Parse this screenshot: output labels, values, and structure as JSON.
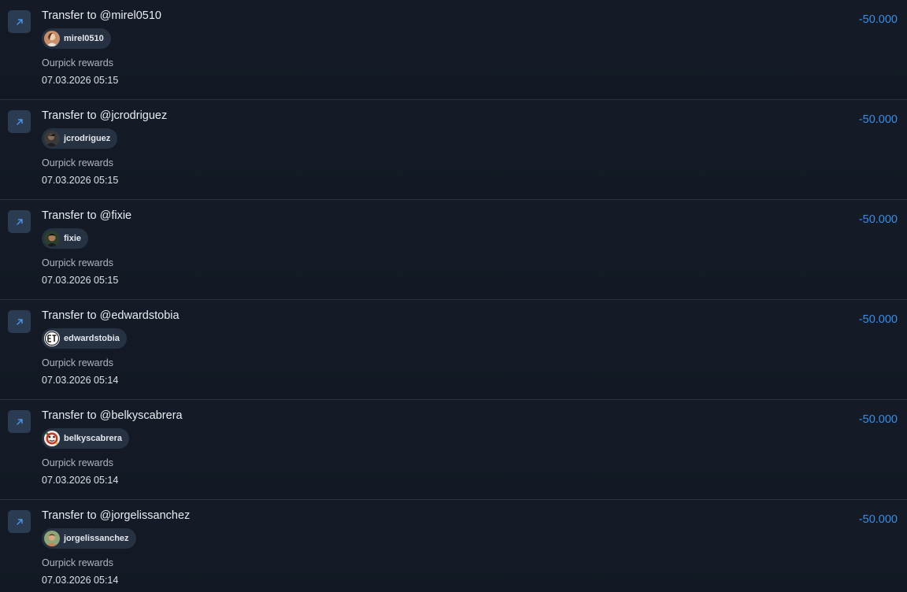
{
  "colors": {
    "background": "#131a25",
    "amount": "#3b8de6",
    "icon_bg": "#2b3b52",
    "icon_arrow": "#4d95e8",
    "chip_bg": "#263242"
  },
  "transactions": [
    {
      "icon": "arrow-up-right-icon",
      "title": "Transfer to @mirel0510",
      "username": "mirel0510",
      "category": "Ourpick rewards",
      "timestamp": "07.03.2026 05:15",
      "amount": "-50.000"
    },
    {
      "icon": "arrow-up-right-icon",
      "title": "Transfer to @jcrodriguez",
      "username": "jcrodriguez",
      "category": "Ourpick rewards",
      "timestamp": "07.03.2026 05:15",
      "amount": "-50.000"
    },
    {
      "icon": "arrow-up-right-icon",
      "title": "Transfer to @fixie",
      "username": "fixie",
      "category": "Ourpick rewards",
      "timestamp": "07.03.2026 05:15",
      "amount": "-50.000"
    },
    {
      "icon": "arrow-up-right-icon",
      "title": "Transfer to @edwardstobia",
      "username": "edwardstobia",
      "category": "Ourpick rewards",
      "timestamp": "07.03.2026 05:14",
      "amount": "-50.000"
    },
    {
      "icon": "arrow-up-right-icon",
      "title": "Transfer to @belkyscabrera",
      "username": "belkyscabrera",
      "category": "Ourpick rewards",
      "timestamp": "07.03.2026 05:14",
      "amount": "-50.000"
    },
    {
      "icon": "arrow-up-right-icon",
      "title": "Transfer to @jorgelissanchez",
      "username": "jorgelissanchez",
      "category": "Ourpick rewards",
      "timestamp": "07.03.2026 05:14",
      "amount": "-50.000"
    }
  ]
}
